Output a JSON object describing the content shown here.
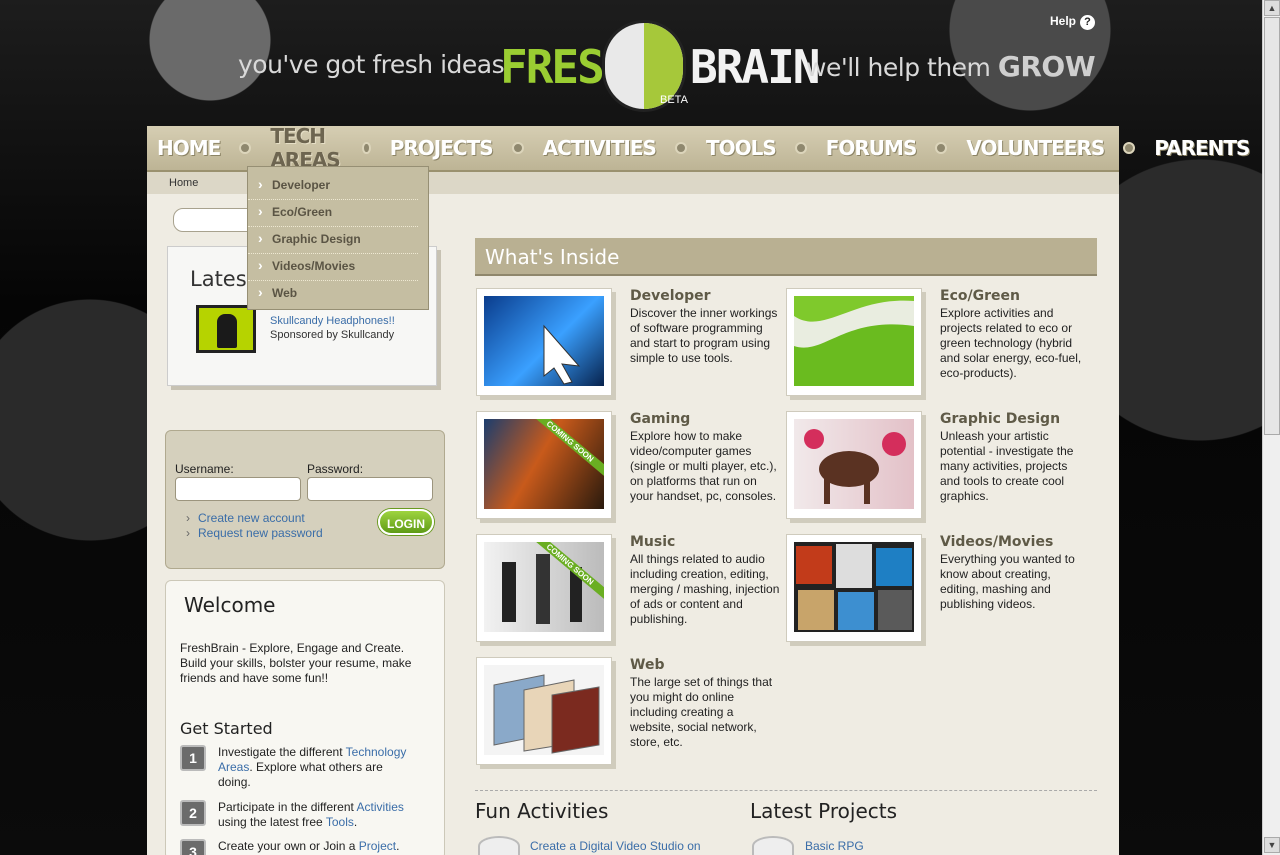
{
  "header": {
    "tagline_left": "you've got fresh ideas",
    "tagline_right_pre": "we'll help them",
    "tagline_right_bold": "GROW",
    "logo_fresh": "FRESH",
    "logo_brain": "BRAIN",
    "logo_beta": "BETA",
    "help_label": "Help",
    "help_icon": "?"
  },
  "nav": {
    "items": [
      "HOME",
      "TECH AREAS",
      "PROJECTS",
      "ACTIVITIES",
      "TOOLS",
      "FORUMS",
      "VOLUNTEERS",
      "PARENTS"
    ],
    "active": "TECH AREAS"
  },
  "dropdown": {
    "items": [
      "Developer",
      "Eco/Green",
      "Graphic Design",
      "Videos/Movies",
      "Web"
    ]
  },
  "breadcrumb": "Home",
  "latest": {
    "title": "Latest",
    "link": "Skullcandy Headphones!!",
    "sponsor": "Sponsored by Skullcandy"
  },
  "login": {
    "username_label": "Username:",
    "password_label": "Password:",
    "username_value": "",
    "password_value": "",
    "links": [
      "Create new account",
      "Request new password"
    ],
    "button": "LOGIN"
  },
  "welcome": {
    "title": "Welcome",
    "text": "FreshBrain - Explore, Engage and Create. Build your skills, bolster your resume, make friends and have some fun!!",
    "getstarted_title": "Get Started",
    "steps": [
      {
        "num": "1",
        "pre": "Investigate the different ",
        "link": "Technology Areas",
        "post": ". Explore what others are doing."
      },
      {
        "num": "2",
        "pre": "Participate in the different ",
        "link": "Activities",
        "mid": " using the latest free ",
        "link2": "Tools",
        "post": "."
      },
      {
        "num": "3",
        "pre": "Create your own or Join a ",
        "link": "Project",
        "post": "."
      }
    ]
  },
  "whats_inside": {
    "title": "What's Inside",
    "coming_soon": "COMING SOON",
    "tiles": [
      {
        "title": "Developer",
        "desc": "Discover the inner workings of software programming and start to program using simple to use tools."
      },
      {
        "title": "Eco/Green",
        "desc": "Explore activities and projects related to eco or green technology (hybrid and solar energy, eco-fuel, eco-products)."
      },
      {
        "title": "Gaming",
        "desc": "Explore how to make video/computer games (single or multi player, etc.), on platforms that run on your handset, pc, consoles."
      },
      {
        "title": "Graphic Design",
        "desc": "Unleash your artistic potential - investigate the many activities, projects and tools to create cool graphics."
      },
      {
        "title": "Music",
        "desc": "All things related to audio including creation, editing, merging / mashing, injection of ads or content and publishing."
      },
      {
        "title": "Videos/Movies",
        "desc": "Everything you wanted to know about creating, editing, mashing and publishing videos."
      },
      {
        "title": "Web",
        "desc": "The large set of things that you might do online including creating a website, social network, store, etc."
      }
    ]
  },
  "bottom": {
    "fun_title": "Fun Activities",
    "fun_link": "Create a Digital Video Studio on",
    "projects_title": "Latest Projects",
    "projects_link": "Basic RPG"
  },
  "colors": {
    "accent_green": "#9acd32",
    "nav_bg": "#c9c1a4",
    "link_blue": "#3a6da8"
  }
}
